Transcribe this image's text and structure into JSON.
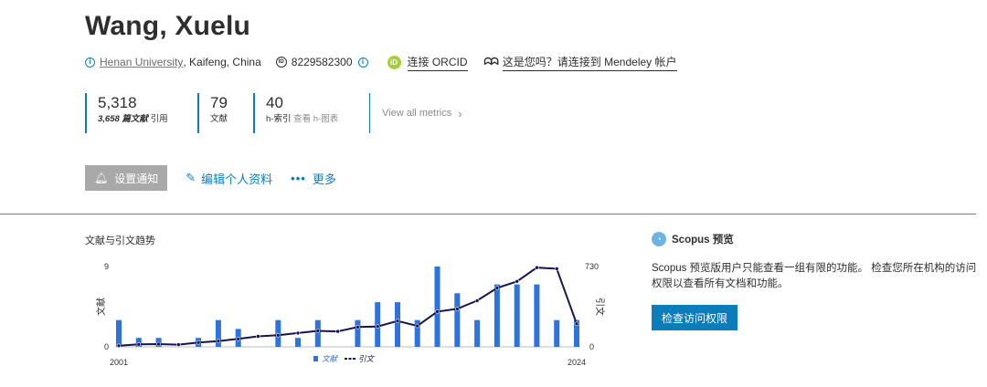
{
  "author": {
    "name": "Wang, Xuelu"
  },
  "info": {
    "affiliation": "Henan University",
    "location": ", Kaifeng, China",
    "scopus_id": "8229582300",
    "orcid_label": "连接 ORCID",
    "mendeley_label": "这是您吗？请连接到 Mendeley 帐户"
  },
  "metrics": {
    "citations": {
      "value": "5,318",
      "docs_count": "3,658",
      "docs_word": "篇文献",
      "suffix": "引用"
    },
    "documents": {
      "value": "79",
      "label": "文献"
    },
    "h_index": {
      "value": "40",
      "label": "h-索引",
      "view": "查看 h-图表"
    },
    "view_all": "View all metrics"
  },
  "actions": {
    "alert": "设置通知",
    "edit_profile": "编辑个人资料",
    "more": "更多"
  },
  "chart_data": {
    "type": "bar",
    "title": "文献与引文趋势",
    "ylabel_left": "文献",
    "ylabel_right": "引文",
    "x_start_label": "2001",
    "x_end_label": "2024",
    "left_ticks": [
      "9",
      "0"
    ],
    "right_ticks": [
      "730",
      "0"
    ],
    "ylim_left": [
      0,
      9
    ],
    "ylim_right": [
      0,
      730
    ],
    "years": [
      2001,
      2002,
      2003,
      2004,
      2005,
      2006,
      2007,
      2008,
      2009,
      2010,
      2011,
      2012,
      2013,
      2014,
      2015,
      2016,
      2017,
      2018,
      2019,
      2020,
      2021,
      2022,
      2023,
      2024
    ],
    "series": [
      {
        "name": "文献",
        "type": "bar",
        "color": "#2d73e0",
        "values": [
          3,
          1,
          1,
          0,
          1,
          3,
          2,
          0,
          3,
          1,
          3,
          0,
          3,
          5,
          5,
          3,
          9,
          6,
          3,
          7,
          7,
          7,
          3,
          3
        ]
      },
      {
        "name": "引文",
        "type": "line",
        "color": "#15154f",
        "values": [
          10,
          22,
          25,
          20,
          40,
          52,
          72,
          95,
          105,
          125,
          145,
          140,
          180,
          185,
          235,
          190,
          320,
          345,
          420,
          535,
          595,
          720,
          710,
          210
        ]
      }
    ],
    "legend_position": "bottom"
  },
  "preview": {
    "title": "Scopus 预览",
    "text": "Scopus 预览版用户只能查看一组有限的功能。 检查您所在机构的访问权限以查看所有文档和功能。",
    "button": "检查访问权限"
  },
  "colors": {
    "accent": "#0c7dbb",
    "bar": "#2d73e0",
    "line": "#15154f",
    "orcid": "#a6ce39"
  }
}
